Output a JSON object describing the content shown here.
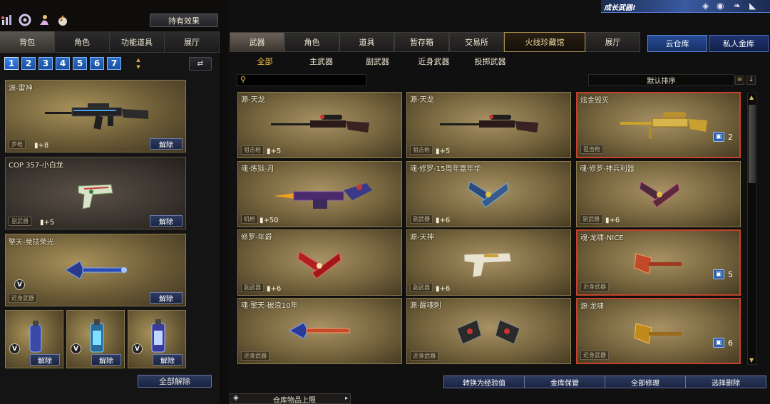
{
  "top_icons": [
    "stats-icon",
    "refresh-icon",
    "character-icon",
    "inventory-icon"
  ],
  "hold_effect_label": "持有效果",
  "left_tabs": [
    {
      "label": "背包",
      "active": true
    },
    {
      "label": "角色",
      "active": false
    },
    {
      "label": "功能道具",
      "active": false
    },
    {
      "label": "展厅",
      "active": false
    }
  ],
  "pages": [
    "1",
    "2",
    "3",
    "4",
    "5",
    "6",
    "7"
  ],
  "current_page": "1",
  "inventory": [
    {
      "name": "源-雷神",
      "category": "步枪",
      "plus": "+8",
      "release": "解除"
    },
    {
      "name": "COP 357-小白龙",
      "category": "副武器",
      "plus": "+5",
      "release": "解除"
    },
    {
      "name": "擎天-竞技荣光",
      "category": "近身武器",
      "plus": "",
      "release": "解除"
    },
    {
      "name": "",
      "category": "",
      "plus": "",
      "release": "解除"
    },
    {
      "name": "",
      "category": "",
      "plus": "",
      "release": "解除"
    },
    {
      "name": "",
      "category": "",
      "plus": "",
      "release": "解除"
    }
  ],
  "release_all_label": "全部解除",
  "warehouse_limit_label": "仓库物品上限",
  "right_tabs": [
    {
      "label": "武器",
      "active": true
    },
    {
      "label": "角色",
      "active": false
    },
    {
      "label": "道具",
      "active": false
    },
    {
      "label": "暂存箱",
      "active": false
    },
    {
      "label": "交易所",
      "active": false
    },
    {
      "label": "火线珍藏馆",
      "active": false
    },
    {
      "label": "展厅",
      "active": false
    }
  ],
  "cloud_tabs": [
    "云仓库",
    "私人金库"
  ],
  "sub_tabs": [
    {
      "label": "全部",
      "active": true
    },
    {
      "label": "主武器",
      "active": false
    },
    {
      "label": "副武器",
      "active": false
    },
    {
      "label": "近身武器",
      "active": false
    },
    {
      "label": "投掷武器",
      "active": false
    }
  ],
  "search": {
    "placeholder": ""
  },
  "sort_label": "默认排序",
  "banner_text": "成长武器!",
  "grid": [
    {
      "name": "源-天龙",
      "category": "狙击枪",
      "plus": "+5",
      "count": ""
    },
    {
      "name": "源-天龙",
      "category": "狙击枪",
      "plus": "+5",
      "count": ""
    },
    {
      "name": "炫金毁灭",
      "category": "狙击枪",
      "plus": "",
      "count": "2"
    },
    {
      "name": "魂·炼狱-月",
      "category": "机枪",
      "plus": "+50",
      "count": ""
    },
    {
      "name": "魂·修罗-15周年嘉年华",
      "category": "副武器",
      "plus": "+6",
      "count": ""
    },
    {
      "name": "魂·修罗-神兵利器",
      "category": "副武器",
      "plus": "+6",
      "count": ""
    },
    {
      "name": "修罗-年爵",
      "category": "副武器",
      "plus": "+6",
      "count": ""
    },
    {
      "name": "源-天神",
      "category": "副武器",
      "plus": "+6",
      "count": ""
    },
    {
      "name": "魂·龙啸-NICE",
      "category": "近身武器",
      "plus": "",
      "count": "5"
    },
    {
      "name": "魂·擎天-破浪10年",
      "category": "近身武器",
      "plus": "",
      "count": ""
    },
    {
      "name": "源-醒魂刺",
      "category": "近身武器",
      "plus": "",
      "count": ""
    },
    {
      "name": "源·龙啸",
      "category": "近身武器",
      "plus": "",
      "count": "6"
    }
  ],
  "bottom_buttons": [
    "转换为经验值",
    "金库保管",
    "全部修理",
    "选择删除"
  ],
  "colors": {
    "gold": "#f5c24a",
    "blue_button": "#2d6fc3",
    "highlight_border": "#c4432a"
  }
}
